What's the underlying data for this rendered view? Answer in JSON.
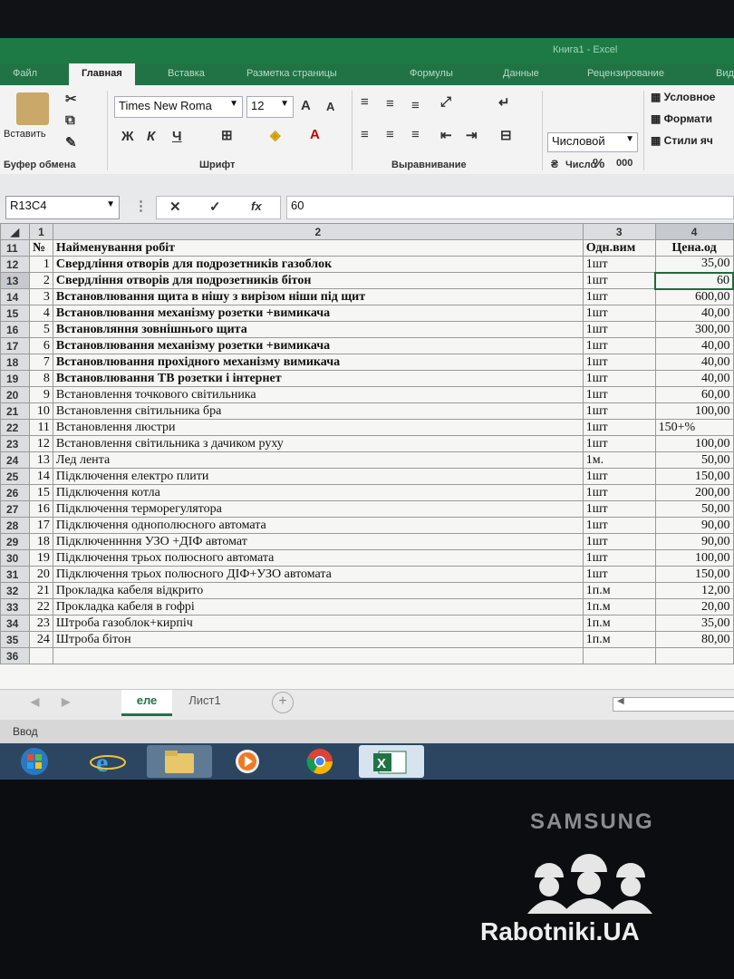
{
  "window": {
    "title": "Книга1 - Excel"
  },
  "tabs": [
    "Файл",
    "Главная",
    "Вставка",
    "Разметка страницы",
    "Формулы",
    "Данные",
    "Рецензирование",
    "Вид"
  ],
  "active_tab": "Главная",
  "ribbon": {
    "clipboard": {
      "paste": "Вставить",
      "label": "Буфер обмена"
    },
    "font": {
      "family": "Times New Roma",
      "size": "12",
      "bold": "Ж",
      "italic": "К",
      "underline": "Ч",
      "label": "Шрифт"
    },
    "alignment": {
      "label": "Выравнивание"
    },
    "number": {
      "format": "Числовой",
      "percent": "%",
      "thousands": "000",
      "label": "Число"
    },
    "styles": {
      "conditional": "Условное",
      "format_table": "Формати",
      "cell_styles": "Стили яч"
    }
  },
  "formula_bar": {
    "name_box": "R13C4",
    "fx": "fx",
    "value": "60"
  },
  "grid": {
    "column_headers": [
      "1",
      "2",
      "3",
      "4"
    ],
    "header_row": {
      "row": "11",
      "c1": "№",
      "c2": "Найменування робіт",
      "c3": "Одн.вим",
      "c4": "Цена.од"
    },
    "rows": [
      {
        "row": "12",
        "n": "1",
        "name": "Свердління отворів для подрозетників газоблок",
        "unit": "1шт",
        "price": "35,00"
      },
      {
        "row": "13",
        "n": "2",
        "name": "Свердління отворів для подрозетників бітон",
        "unit": "1шт",
        "price": "60"
      },
      {
        "row": "14",
        "n": "3",
        "name": "Встановлювання щита в нішу з вирізом ніши під щит",
        "unit": "1шт",
        "price": "600,00"
      },
      {
        "row": "15",
        "n": "4",
        "name": "Встановлювання механізму розетки +вимикача",
        "unit": "1шт",
        "price": "40,00"
      },
      {
        "row": "16",
        "n": "5",
        "name": "Встановляння зовнішнього щита",
        "unit": "1шт",
        "price": "300,00"
      },
      {
        "row": "17",
        "n": "6",
        "name": "Встановлювання механізму розетки +вимикача",
        "unit": "1шт",
        "price": "40,00"
      },
      {
        "row": "18",
        "n": "7",
        "name": "Встановлювання прохідного механізму вимикача",
        "unit": "1шт",
        "price": "40,00"
      },
      {
        "row": "19",
        "n": "8",
        "name": "Встановлювання ТВ розетки і інтернет",
        "unit": "1шт",
        "price": "40,00"
      },
      {
        "row": "20",
        "n": "9",
        "name": "Встановлення точкового світильника",
        "unit": "1шт",
        "price": "60,00"
      },
      {
        "row": "21",
        "n": "10",
        "name": "Встановлення світильника бра",
        "unit": "1шт",
        "price": "100,00"
      },
      {
        "row": "22",
        "n": "11",
        "name": "Встановлення люстри",
        "unit": "1шт",
        "price": "150+%"
      },
      {
        "row": "23",
        "n": "12",
        "name": "Встановлення світильника з дачиком руху",
        "unit": "1шт",
        "price": "100,00"
      },
      {
        "row": "24",
        "n": "13",
        "name": "Лед лента",
        "unit": "1м.",
        "price": "50,00"
      },
      {
        "row": "25",
        "n": "14",
        "name": "Підключення електро плити",
        "unit": "1шт",
        "price": "150,00"
      },
      {
        "row": "26",
        "n": "15",
        "name": "Підключення котла",
        "unit": "1шт",
        "price": "200,00"
      },
      {
        "row": "27",
        "n": "16",
        "name": "Підключення терморегулятора",
        "unit": "1шт",
        "price": "50,00"
      },
      {
        "row": "28",
        "n": "17",
        "name": "Підключення однополюсного автомата",
        "unit": "1шт",
        "price": "90,00"
      },
      {
        "row": "29",
        "n": "18",
        "name": "Підключеннння УЗО +ДІФ автомат",
        "unit": "1шт",
        "price": "90,00"
      },
      {
        "row": "30",
        "n": "19",
        "name": "Підключення трьох полюсного автомата",
        "unit": "1шт",
        "price": "100,00"
      },
      {
        "row": "31",
        "n": "20",
        "name": "Підключення трьох полюсного ДІФ+УЗО автомата",
        "unit": "1шт",
        "price": "150,00"
      },
      {
        "row": "32",
        "n": "21",
        "name": "Прокладка кабеля відкрито",
        "unit": "1п.м",
        "price": "12,00"
      },
      {
        "row": "33",
        "n": "22",
        "name": "Прокладка кабеля в гофрі",
        "unit": "1п.м",
        "price": "20,00"
      },
      {
        "row": "34",
        "n": "23",
        "name": "Штроба газоблок+кирпіч",
        "unit": "1п.м",
        "price": "35,00"
      },
      {
        "row": "35",
        "n": "24",
        "name": "Штроба бітон",
        "unit": "1п.м",
        "price": "80,00"
      }
    ],
    "last_row": "36"
  },
  "sheet_tabs": [
    "еле",
    "Лист1"
  ],
  "status": {
    "mode": "Ввод"
  },
  "taskbar": {
    "icons": [
      "start-orb-icon",
      "internet-explorer-icon",
      "file-explorer-icon",
      "media-player-icon",
      "chrome-icon",
      "excel-icon"
    ]
  },
  "device": {
    "brand": "SAMSUNG"
  },
  "watermark": {
    "text": "Rabotniki.UA"
  },
  "colors": {
    "excel_green": "#217346",
    "taskbar": "#2c4661"
  }
}
